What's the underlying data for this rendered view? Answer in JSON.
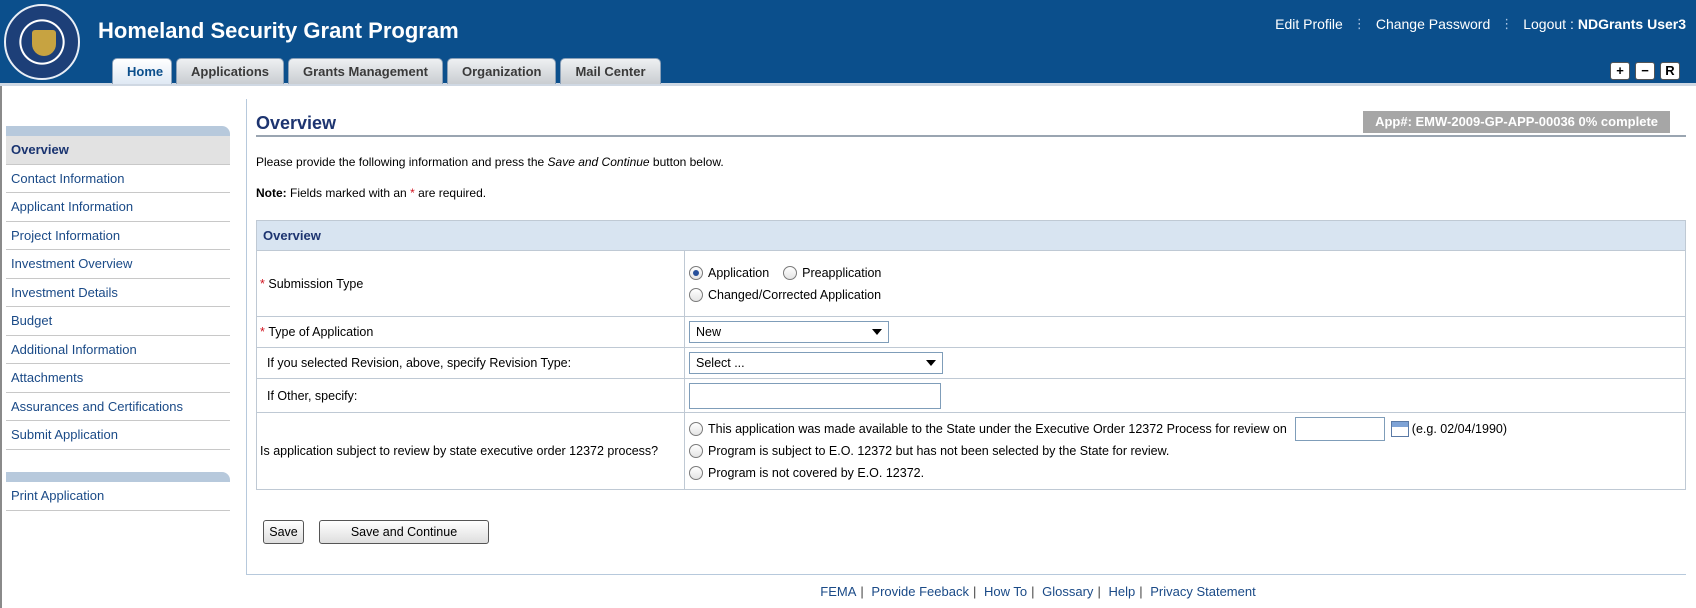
{
  "header": {
    "title": "Homeland Security Grant Program",
    "links": [
      "Edit Profile",
      "Change Password",
      "Logout :"
    ],
    "user": "NDGrants User3",
    "tabs": [
      "Home",
      "Applications",
      "Grants Management",
      "Organization",
      "Mail Center"
    ],
    "active_tab": "Home",
    "size_buttons": [
      "+",
      "−",
      "R"
    ]
  },
  "sidebar": {
    "items": [
      "Overview",
      "Contact Information",
      "Applicant Information",
      "Project Information",
      "Investment Overview",
      "Investment Details",
      "Budget",
      "Additional Information",
      "Attachments",
      "Assurances and Certifications",
      "Submit Application"
    ],
    "active": "Overview",
    "print": "Print Application"
  },
  "main": {
    "title": "Overview",
    "app_badge": "App#: EMW-2009-GP-APP-00036 0% complete",
    "intro_before": "Please provide the following information and press the ",
    "intro_em": "Save and Continue",
    "intro_after": " button below.",
    "note_bold": "Note:",
    "note_text": " Fields marked with an ",
    "note_star": "*",
    "note_end": " are required.",
    "section": "Overview",
    "submission_type": {
      "label": "Submission Type",
      "options": [
        "Application",
        "Preapplication",
        "Changed/Corrected Application"
      ],
      "selected": "Application"
    },
    "type_of_application": {
      "label": "Type of Application",
      "value": "New"
    },
    "revision": {
      "label": "If you selected Revision, above, specify Revision Type:",
      "value": "Select ..."
    },
    "other": {
      "label": "If Other, specify:",
      "value": ""
    },
    "review": {
      "label": "Is application subject to review by state executive order 12372 process?",
      "options": [
        "This application was made available to the State under the Executive Order 12372 Process for review on",
        "Program is subject to E.O. 12372 but has not been selected by the State for review.",
        "Program is not covered by E.O. 12372."
      ],
      "date_hint": "(e.g. 02/04/1990)",
      "date_value": ""
    },
    "buttons": {
      "save": "Save",
      "save_continue": "Save and Continue"
    }
  },
  "footer": {
    "links": [
      "FEMA",
      "Provide Feeback",
      "How To",
      "Glossary",
      "Help",
      "Privacy Statement"
    ]
  },
  "colors": {
    "header_bg": "#0b4f8c",
    "accent": "#1d3470",
    "link": "#1a4a87",
    "required": "#d0131f"
  }
}
